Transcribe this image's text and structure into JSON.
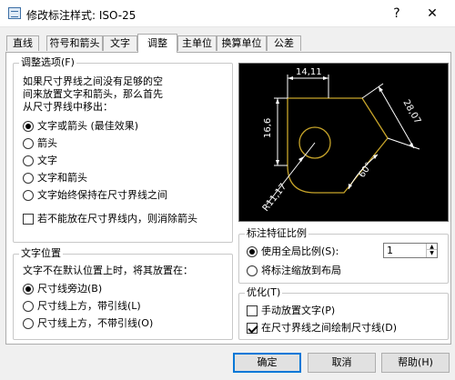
{
  "window": {
    "title": "修改标注样式: ISO-25",
    "help_glyph": "?",
    "close_glyph": "✕"
  },
  "tabs": [
    {
      "label": "直线",
      "active": false
    },
    {
      "label": "符号和箭头",
      "active": false
    },
    {
      "label": "文字",
      "active": false
    },
    {
      "label": "调整",
      "active": true
    },
    {
      "label": "主单位",
      "active": false
    },
    {
      "label": "换算单位",
      "active": false
    },
    {
      "label": "公差",
      "active": false
    }
  ],
  "fit_options": {
    "title": "调整选项(F)",
    "description": [
      "如果尺寸界线之间没有足够的空",
      "间来放置文字和箭头，那么首先",
      "从尺寸界线中移出："
    ],
    "options": [
      {
        "label": "文字或箭头 (最佳效果)",
        "selected": true
      },
      {
        "label": "箭头",
        "selected": false
      },
      {
        "label": "文字",
        "selected": false
      },
      {
        "label": "文字和箭头",
        "selected": false
      },
      {
        "label": "文字始终保持在尺寸界线之间",
        "selected": false
      }
    ],
    "suppress_arrows": {
      "label": "若不能放在尺寸界线内，则消除箭头",
      "checked": false
    }
  },
  "text_placement": {
    "title": "文字位置",
    "description": "文字不在默认位置上时，将其放置在：",
    "options": [
      {
        "label": "尺寸线旁边(B)",
        "selected": true
      },
      {
        "label": "尺寸线上方，带引线(L)",
        "selected": false
      },
      {
        "label": "尺寸线上方，不带引线(O)",
        "selected": false
      }
    ]
  },
  "scale": {
    "title": "标注特征比例",
    "options": [
      {
        "label": "使用全局比例(S):",
        "selected": true
      },
      {
        "label": "将标注缩放到布局",
        "selected": false
      }
    ],
    "value": "1",
    "spin_up": "▲",
    "spin_down": "▼"
  },
  "finetune": {
    "title": "优化(T)",
    "options": [
      {
        "label": "手动放置文字(P)",
        "checked": false
      },
      {
        "label": "在尺寸界线之间绘制尺寸线(D)",
        "checked": true
      }
    ]
  },
  "preview": {
    "dims": {
      "top": "14,11",
      "left": "16,6",
      "right": "28,07",
      "angle": "60°",
      "radius": "R11,17"
    },
    "colors": {
      "background": "#000000",
      "geometry": "#c8a52a",
      "dimension": "#ffffff"
    }
  },
  "buttons": {
    "ok": "确定",
    "cancel": "取消",
    "help": "帮助(H)"
  }
}
